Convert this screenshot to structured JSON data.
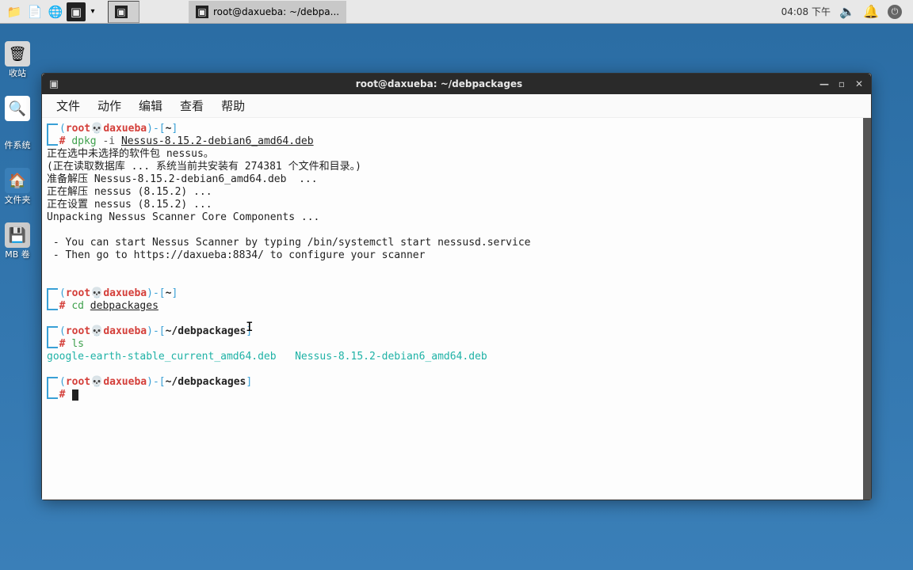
{
  "panel": {
    "clock": "04:08 下午",
    "taskbar": {
      "item1_title": "",
      "item2_title": "root@daxueba: ~/debpa..."
    }
  },
  "desktop": {
    "trash_label": "收站",
    "search_label": "",
    "system_label": "件系统",
    "folder_label": "文件夹",
    "volume_label": "MB 卷"
  },
  "terminal": {
    "title": "root@daxueba: ~/debpackages",
    "menus": {
      "file": "文件",
      "action": "动作",
      "edit": "编辑",
      "view": "查看",
      "help": "帮助"
    },
    "user": "root",
    "host": "daxueba",
    "path_home": "~",
    "path_deb": "~/debpackages",
    "cmd1": "dpkg",
    "cmd1_opt": "-i",
    "cmd1_arg": "Nessus-8.15.2-debian6_amd64.deb",
    "out1": "正在选中未选择的软件包 nessus。",
    "out2": "(正在读取数据库 ... 系统当前共安装有 274381 个文件和目录。)",
    "out3": "准备解压 Nessus-8.15.2-debian6_amd64.deb  ...",
    "out4": "正在解压 nessus (8.15.2) ...",
    "out5": "正在设置 nessus (8.15.2) ...",
    "out6": "Unpacking Nessus Scanner Core Components ...",
    "out7": " - You can start Nessus Scanner by typing /bin/systemctl start nessusd.service",
    "out8": " - Then go to https://daxueba:8834/ to configure your scanner",
    "cmd2": "cd",
    "cmd2_arg": "debpackages",
    "cmd3": "ls",
    "ls_out": "google-earth-stable_current_amd64.deb   Nessus-8.15.2-debian6_amd64.deb"
  }
}
